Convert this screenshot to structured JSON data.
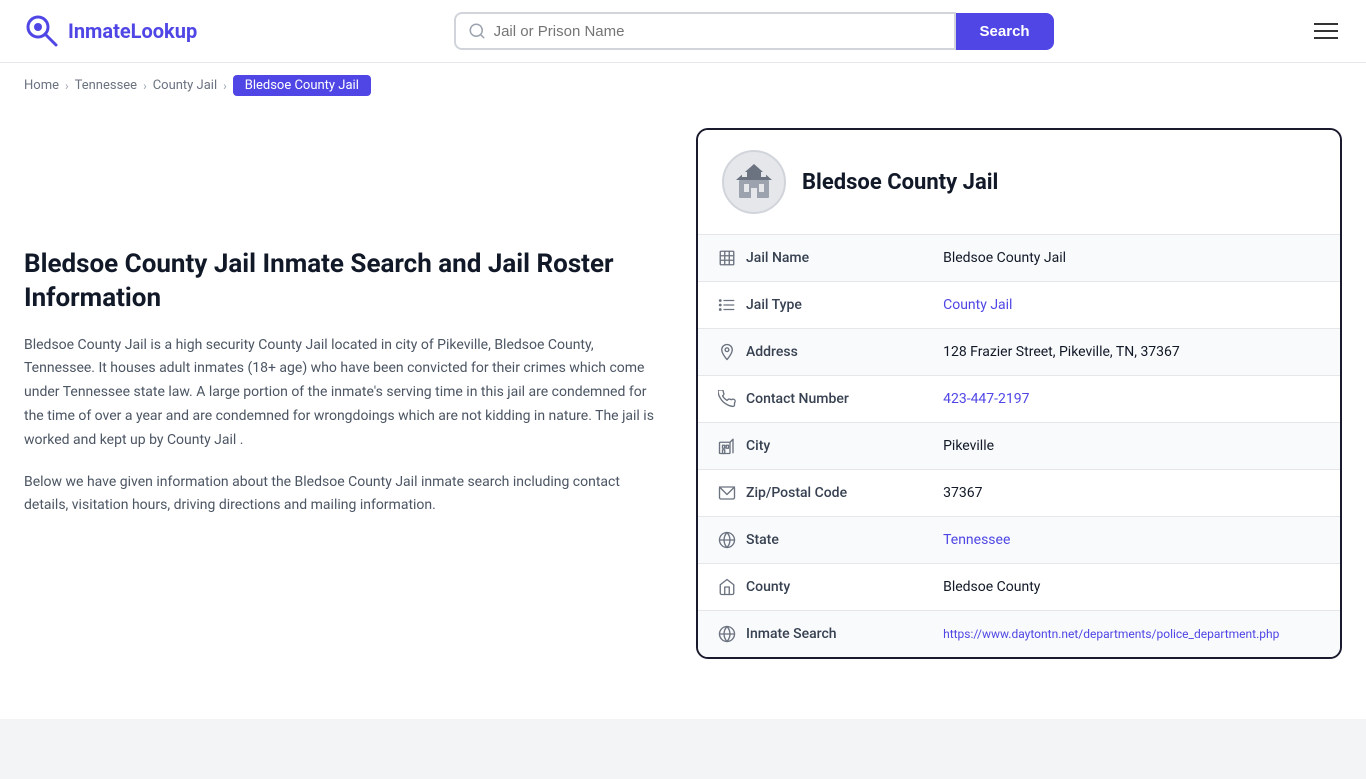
{
  "header": {
    "logo_text_part1": "Inmate",
    "logo_text_part2": "Lookup",
    "search_placeholder": "Jail or Prison Name",
    "search_button_label": "Search"
  },
  "breadcrumb": {
    "items": [
      {
        "label": "Home",
        "href": "#"
      },
      {
        "label": "Tennessee",
        "href": "#"
      },
      {
        "label": "County Jail",
        "href": "#"
      },
      {
        "label": "Bledsoe County Jail",
        "active": true
      }
    ]
  },
  "left": {
    "page_title": "Bledsoe County Jail Inmate Search and Jail Roster Information",
    "description1": "Bledsoe County Jail is a high security County Jail located in city of Pikeville, Bledsoe County, Tennessee. It houses adult inmates (18+ age) who have been convicted for their crimes which come under Tennessee state law. A large portion of the inmate's serving time in this jail are condemned for the time of over a year and are condemned for wrongdoings which are not kidding in nature. The jail is worked and kept up by County Jail .",
    "description2": "Below we have given information about the Bledsoe County Jail inmate search including contact details, visitation hours, driving directions and mailing information."
  },
  "card": {
    "title": "Bledsoe County Jail",
    "rows": [
      {
        "label": "Jail Name",
        "value": "Bledsoe County Jail",
        "link": false,
        "icon": "jail"
      },
      {
        "label": "Jail Type",
        "value": "County Jail",
        "link": true,
        "href": "#",
        "icon": "list"
      },
      {
        "label": "Address",
        "value": "128 Frazier Street, Pikeville, TN, 37367",
        "link": false,
        "icon": "pin"
      },
      {
        "label": "Contact Number",
        "value": "423-447-2197",
        "link": true,
        "href": "tel:4234472197",
        "icon": "phone"
      },
      {
        "label": "City",
        "value": "Pikeville",
        "link": false,
        "icon": "city"
      },
      {
        "label": "Zip/Postal Code",
        "value": "37367",
        "link": false,
        "icon": "mail"
      },
      {
        "label": "State",
        "value": "Tennessee",
        "link": true,
        "href": "#",
        "icon": "globe"
      },
      {
        "label": "County",
        "value": "Bledsoe County",
        "link": false,
        "icon": "county"
      },
      {
        "label": "Inmate Search",
        "value": "https://www.daytontn.net/departments/police_department.php",
        "link": true,
        "href": "https://www.daytontn.net/departments/police_department.php",
        "icon": "globe2"
      }
    ]
  }
}
